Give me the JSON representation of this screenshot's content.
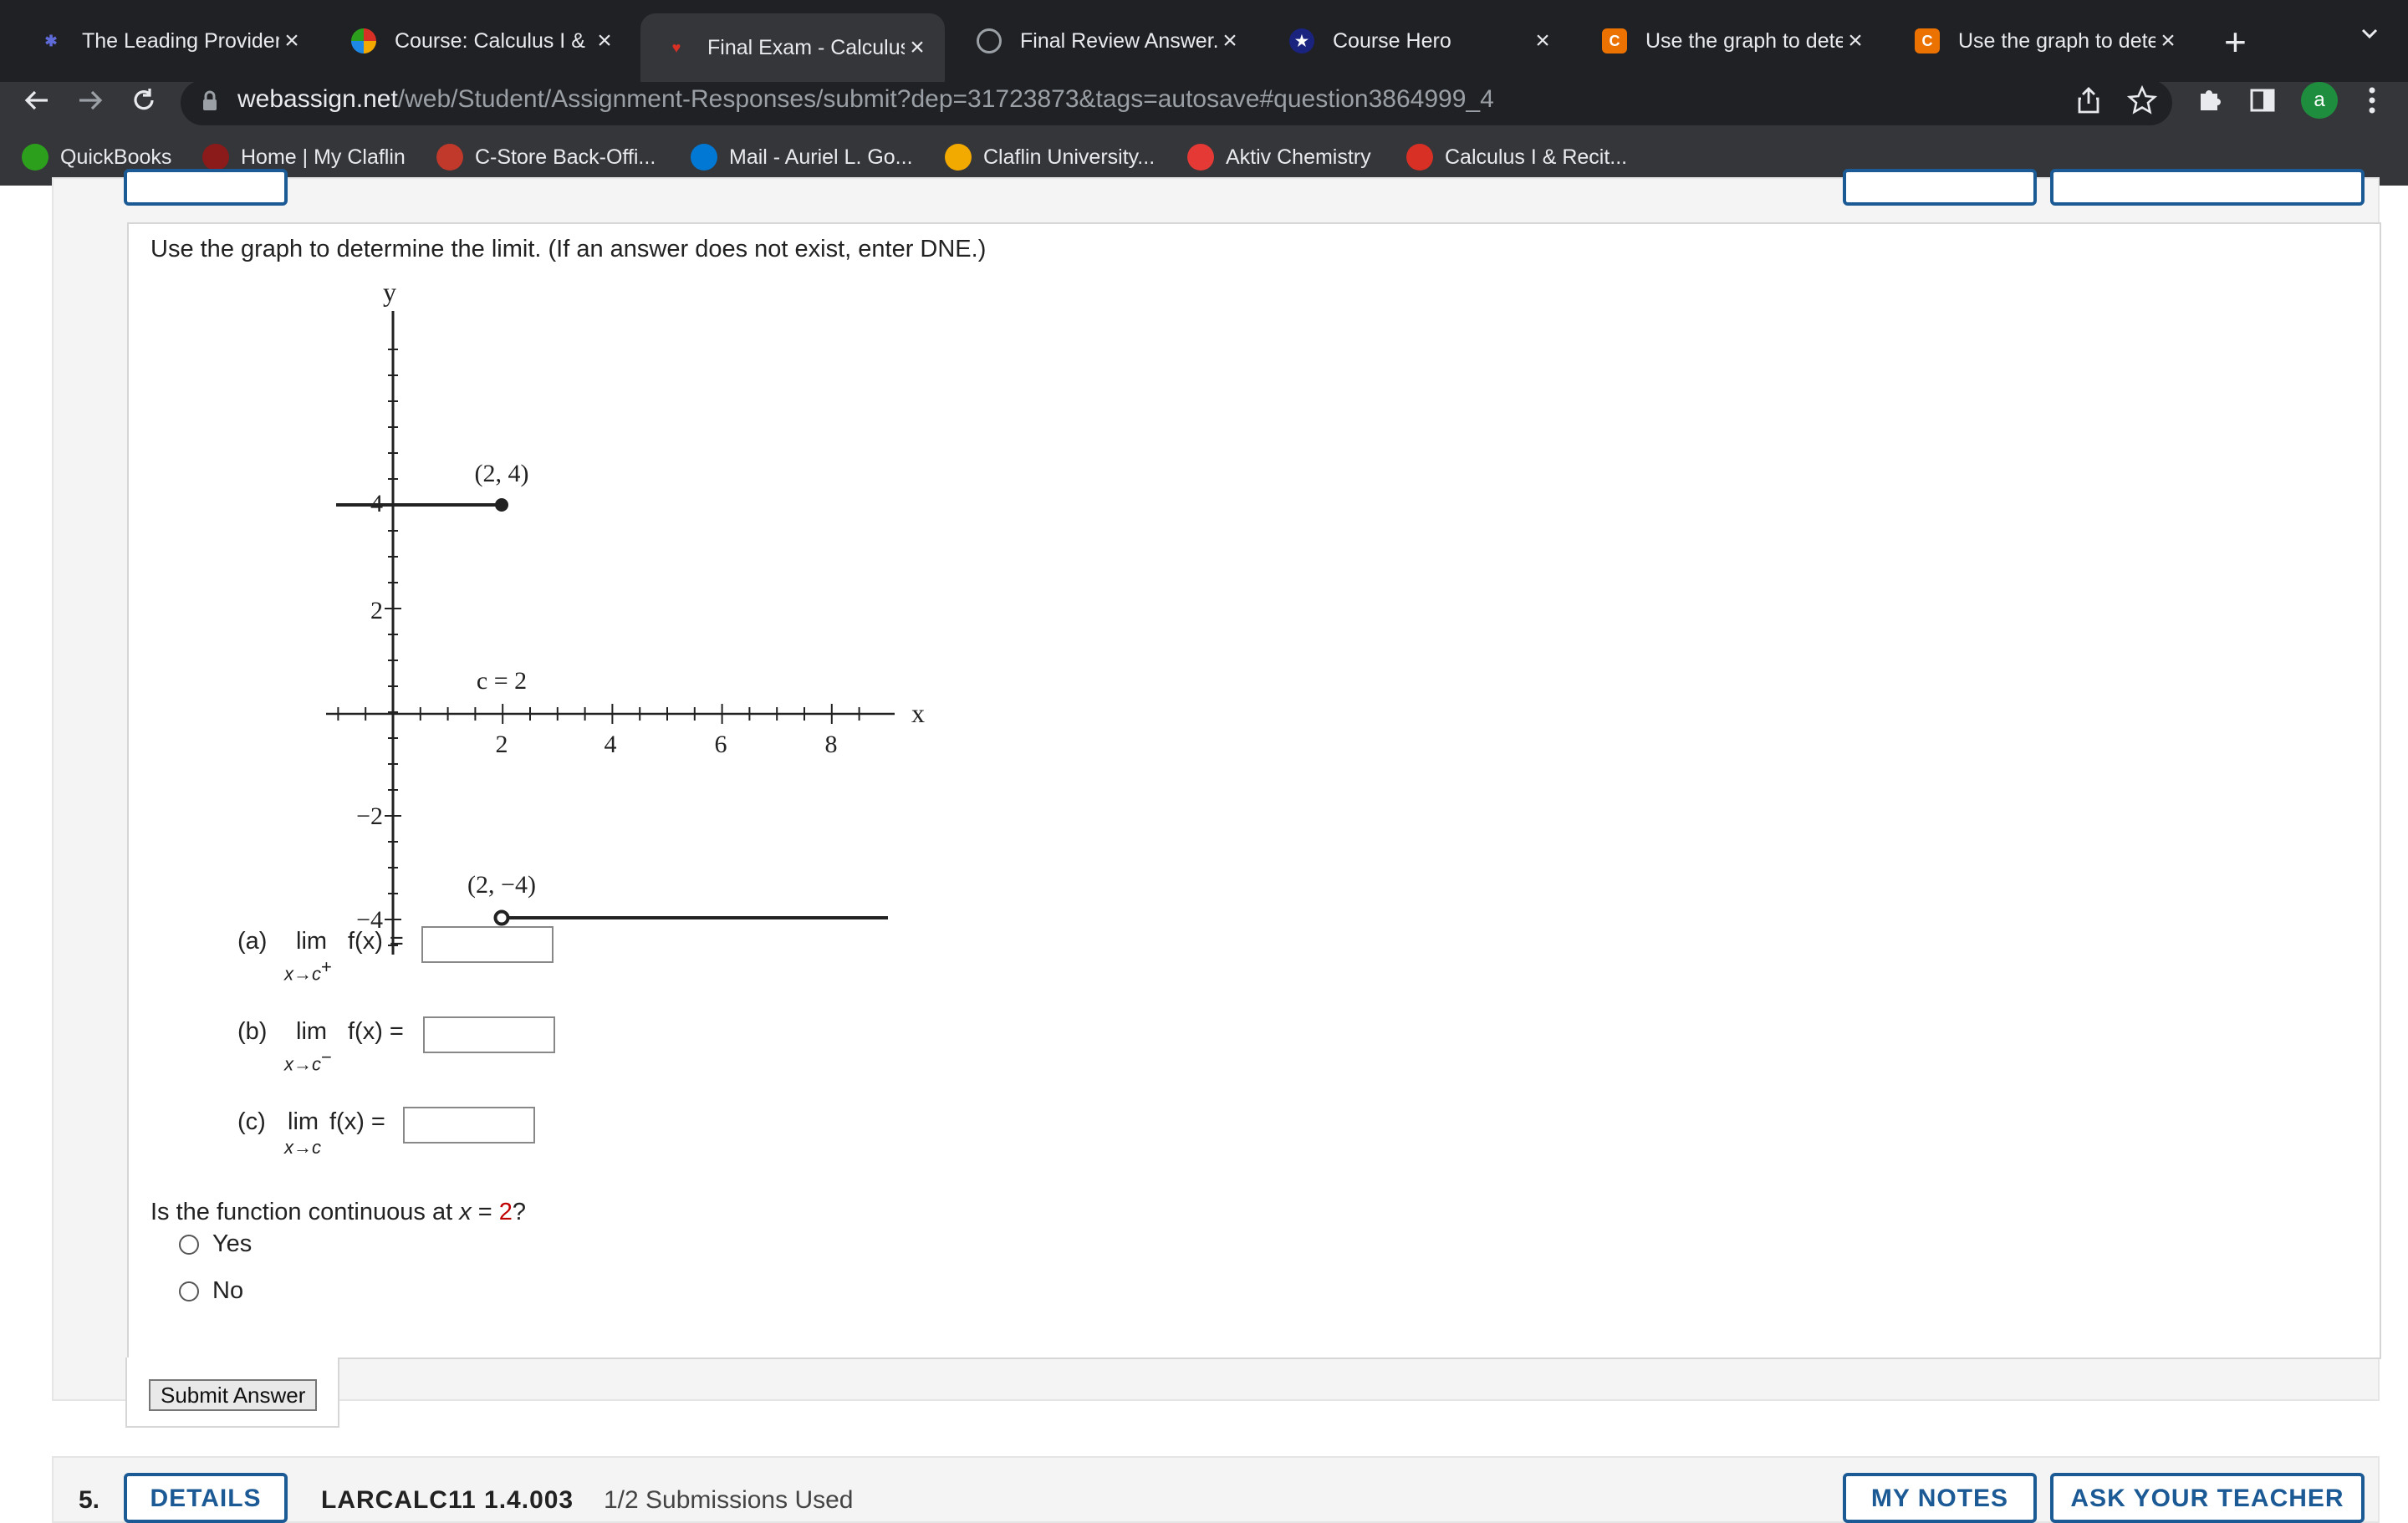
{
  "browser": {
    "tabs": [
      {
        "label": "The Leading Provider",
        "fav": "webassign-icon",
        "color": "#5f6bd8"
      },
      {
        "label": "Course: Calculus I & R",
        "fav": "claflin-icon",
        "color": "#f2a900"
      },
      {
        "label": "Final Exam - Calculus",
        "fav": "pcc-icon",
        "color": "#d93025",
        "active": true
      },
      {
        "label": "Final Review Answer.p",
        "fav": "globe-icon",
        "color": "#9aa0a6"
      },
      {
        "label": "Course Hero",
        "fav": "star-icon",
        "color": "#1a237e"
      },
      {
        "label": "Use the graph to dete",
        "fav": "chegg-icon",
        "color": "#eb7100"
      },
      {
        "label": "Use the graph to dete",
        "fav": "chegg-icon",
        "color": "#eb7100"
      }
    ],
    "url_host": "webassign.net",
    "url_path": "/web/Student/Assignment-Responses/submit?dep=31723873&tags=autosave#question3864999_4",
    "profile_initial": "a",
    "bookmarks": [
      {
        "label": "QuickBooks",
        "color": "#2ca01c"
      },
      {
        "label": "Home | My Claflin",
        "color": "#8b1a1a"
      },
      {
        "label": "C-Store Back-Offi...",
        "color": "#c0392b"
      },
      {
        "label": "Mail - Auriel L. Go...",
        "color": "#0078d4"
      },
      {
        "label": "Claflin University...",
        "color": "#f2a900"
      },
      {
        "label": "Aktiv Chemistry",
        "color": "#e53935"
      },
      {
        "label": "Calculus I & Recit...",
        "color": "#d93025"
      }
    ]
  },
  "question": {
    "prompt": "Use the graph to determine the limit. (If an answer does not exist, enter DNE.)",
    "graph": {
      "y_axis_label": "y",
      "x_axis_label": "x",
      "y_ticks": [
        "4",
        "2",
        "−2",
        "−4"
      ],
      "x_ticks": [
        "2",
        "4",
        "6",
        "8"
      ],
      "point_top_label": "(2, 4)",
      "point_bottom_label": "(2, −4)",
      "c_label": "c = 2"
    },
    "parts": [
      {
        "label": "(a)",
        "lim": "lim",
        "sub": "x→c",
        "sup": "+",
        "fx": "f(x)  =",
        "value": ""
      },
      {
        "label": "(b)",
        "lim": "lim",
        "sub": "x→c",
        "sup": "−",
        "fx": "f(x)  =",
        "value": ""
      },
      {
        "label": "(c)",
        "lim": "lim",
        "sub": "x→c",
        "sup": "",
        "fx": "f(x)  =",
        "value": ""
      }
    ],
    "continuity_prefix": "Is the function continuous at ",
    "continuity_var": "x",
    "continuity_eq": " = ",
    "continuity_value": "2",
    "continuity_suffix": "?",
    "options": [
      "Yes",
      "No"
    ],
    "submit_label": "Submit Answer"
  },
  "next_question": {
    "number": "5.",
    "details_label": "DETAILS",
    "code": "LARCALC11 1.4.003",
    "submissions": "1/2 Submissions Used",
    "my_notes_label": "MY NOTES",
    "ask_teacher_label": "ASK YOUR TEACHER"
  }
}
